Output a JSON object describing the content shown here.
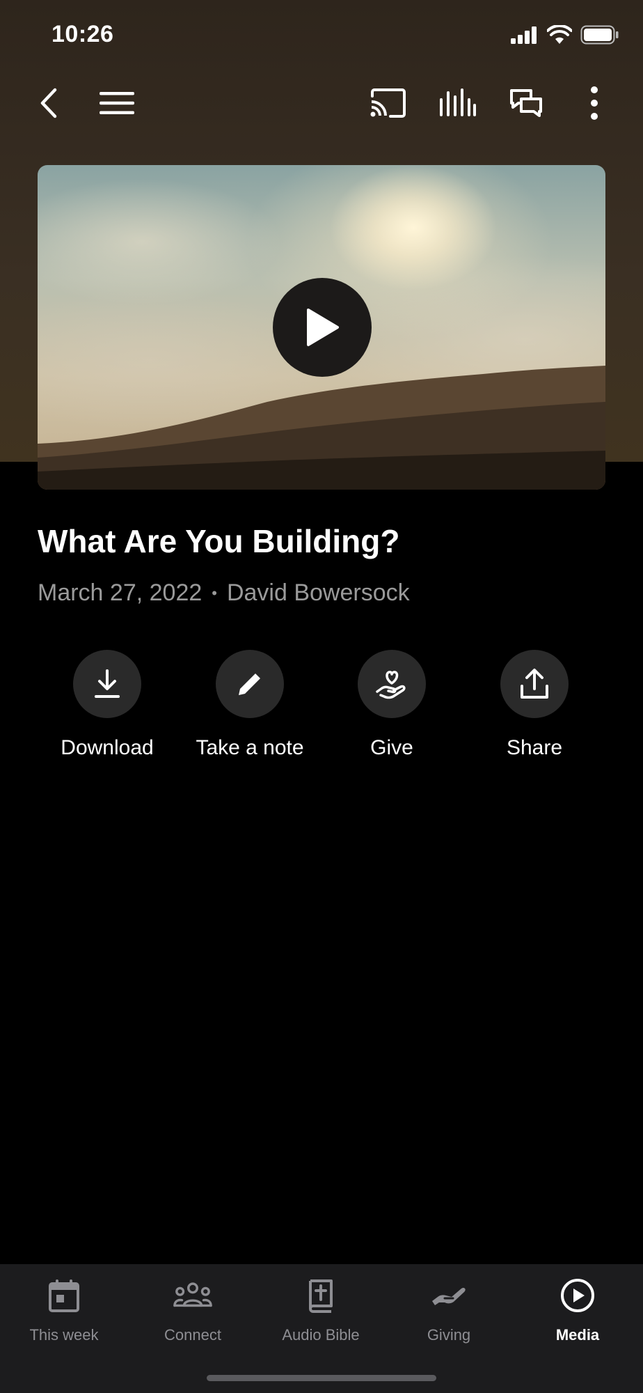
{
  "status_bar": {
    "time": "10:26"
  },
  "colors": {
    "hero_background": "#3a2f23",
    "tab_bar": "#1c1c1e",
    "action_circle": "#2a2a2a",
    "muted_text": "#9a9a9a"
  },
  "top_nav": {
    "icons": [
      "back-chevron-icon",
      "hamburger-menu-icon",
      "cast-icon",
      "audio-bars-icon",
      "chat-bubbles-icon",
      "more-vertical-icon"
    ]
  },
  "media": {
    "title": "What Are You Building?",
    "date": "March 27, 2022",
    "separator": "•",
    "speaker": "David Bowersock"
  },
  "actions": [
    {
      "label": "Download",
      "icon": "download-icon"
    },
    {
      "label": "Take a note",
      "icon": "pencil-icon"
    },
    {
      "label": "Give",
      "icon": "heart-hand-icon"
    },
    {
      "label": "Share",
      "icon": "share-icon"
    }
  ],
  "tabs": [
    {
      "label": "This week",
      "icon": "calendar-icon",
      "active": false
    },
    {
      "label": "Connect",
      "icon": "people-icon",
      "active": false
    },
    {
      "label": "Audio Bible",
      "icon": "bible-icon",
      "active": false
    },
    {
      "label": "Giving",
      "icon": "giving-hand-icon",
      "active": false
    },
    {
      "label": "Media",
      "icon": "play-circle-icon",
      "active": true
    }
  ]
}
